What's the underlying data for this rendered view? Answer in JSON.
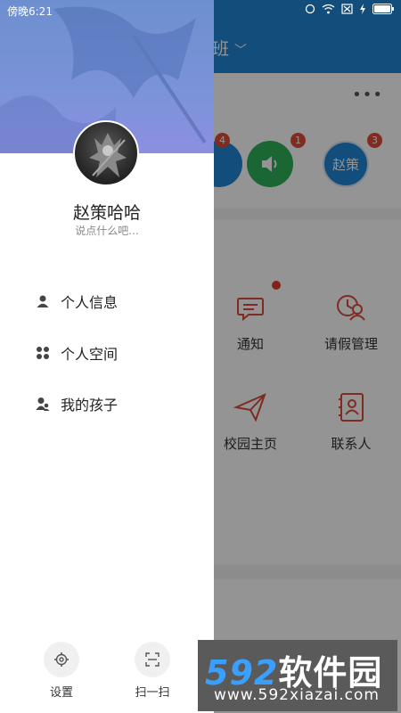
{
  "status_bar": {
    "time": "傍晚6:21"
  },
  "background_app": {
    "header_title": "班",
    "badges": [
      "4",
      "1",
      "3"
    ],
    "avatar_chip_text": "赵策",
    "grid": [
      {
        "label": "通知",
        "icon": "chat-icon"
      },
      {
        "label": "请假管理",
        "icon": "leave-icon"
      },
      {
        "label": "校园主页",
        "icon": "paper-plane-icon"
      },
      {
        "label": "联系人",
        "icon": "contacts-icon"
      }
    ]
  },
  "drawer": {
    "user_name": "赵策哈哈",
    "signature": "说点什么吧...",
    "menu": [
      {
        "label": "个人信息",
        "icon": "person-icon"
      },
      {
        "label": "个人空间",
        "icon": "grid-icon"
      },
      {
        "label": "我的孩子",
        "icon": "child-icon"
      }
    ],
    "bottom": [
      {
        "label": "设置",
        "icon": "gear-icon"
      },
      {
        "label": "扫一扫",
        "icon": "scan-icon"
      }
    ]
  },
  "watermark": {
    "number": "592",
    "brand": "软件园",
    "url": "www.592xiazai.com"
  },
  "colors": {
    "header_blue": "#1f86d4",
    "green": "#2fb15a",
    "badge_red": "#e04a3a",
    "icon_red": "#d94a3c"
  }
}
